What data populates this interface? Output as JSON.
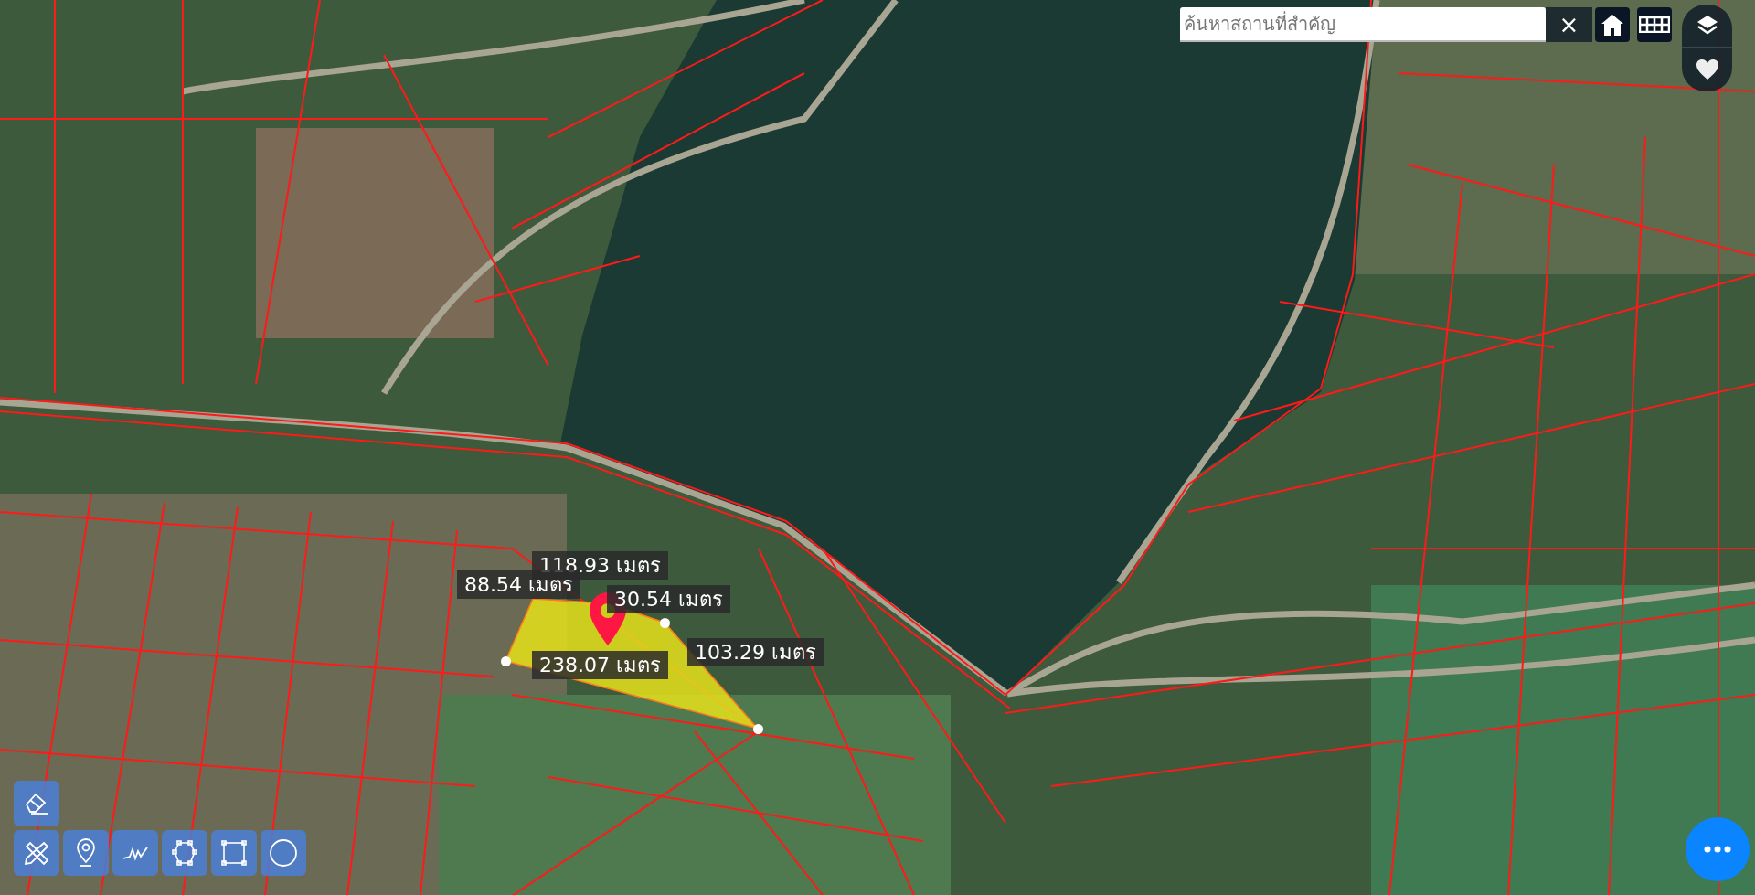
{
  "search": {
    "placeholder": "ค้นหาสถานที่สำคัญ",
    "clear_label": "×"
  },
  "measurements": [
    {
      "text": "118.93 เมตร"
    },
    {
      "text": "88.54 เมตร"
    },
    {
      "text": "30.54 เมตร"
    },
    {
      "text": "238.07 เมตร"
    },
    {
      "text": "103.29 เมตร"
    }
  ]
}
